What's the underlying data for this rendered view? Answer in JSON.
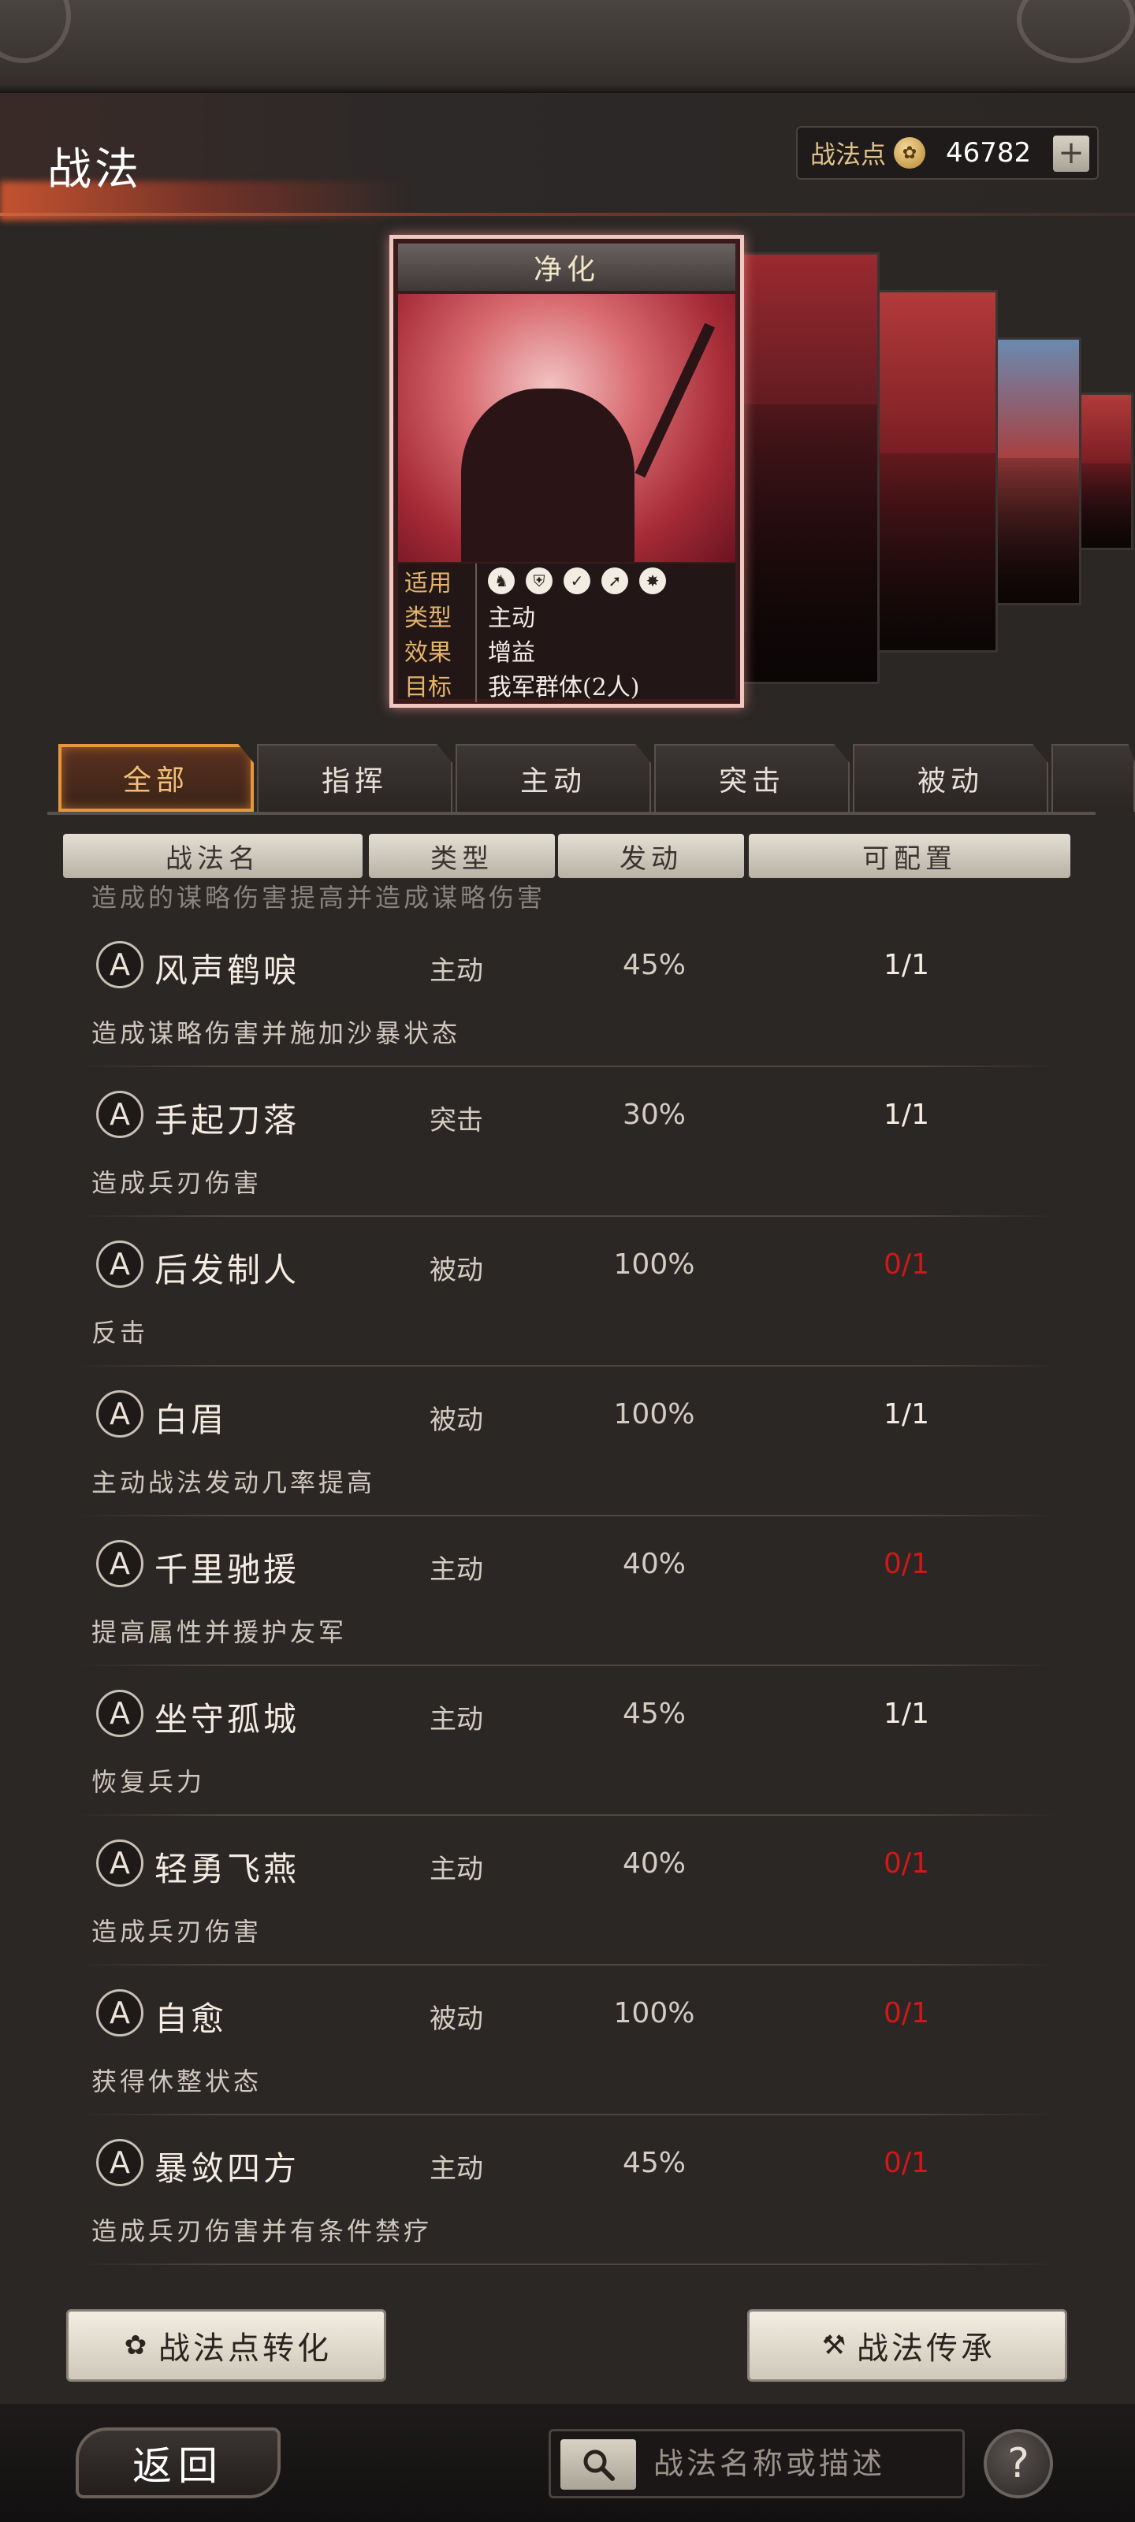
{
  "header": {
    "title": "战法",
    "points_label": "战法点",
    "points_value": "46782",
    "add_label": "+"
  },
  "featured_card": {
    "name": "净化",
    "rows": [
      {
        "key": "适用",
        "value": ""
      },
      {
        "key": "类型",
        "value": "主动"
      },
      {
        "key": "效果",
        "value": "增益"
      },
      {
        "key": "目标",
        "value": "我军群体(2人)"
      }
    ],
    "troop_icons": [
      "cavalry-icon",
      "shield-icon",
      "bow-icon",
      "spear-icon",
      "chariot-icon"
    ]
  },
  "tabs": [
    {
      "label": "全部",
      "active": true
    },
    {
      "label": "指挥",
      "active": false
    },
    {
      "label": "主动",
      "active": false
    },
    {
      "label": "突击",
      "active": false
    },
    {
      "label": "被动",
      "active": false
    }
  ],
  "table_headers": {
    "name": "战法名",
    "type": "类型",
    "rate": "发动",
    "config": "可配置"
  },
  "cut_off_text": "造成的谋略伤害提高并造成谋略伤害",
  "skills": [
    {
      "grade": "A",
      "name": "风声鹤唳",
      "type": "主动",
      "rate": "45%",
      "config": "1/1",
      "desc": "造成谋略伤害并施加沙暴状态",
      "available": true
    },
    {
      "grade": "A",
      "name": "手起刀落",
      "type": "突击",
      "rate": "30%",
      "config": "1/1",
      "desc": "造成兵刃伤害",
      "available": true
    },
    {
      "grade": "A",
      "name": "后发制人",
      "type": "被动",
      "rate": "100%",
      "config": "0/1",
      "desc": "反击",
      "available": false
    },
    {
      "grade": "A",
      "name": "白眉",
      "type": "被动",
      "rate": "100%",
      "config": "1/1",
      "desc": "主动战法发动几率提高",
      "available": true
    },
    {
      "grade": "A",
      "name": "千里驰援",
      "type": "主动",
      "rate": "40%",
      "config": "0/1",
      "desc": "提高属性并援护友军",
      "available": false
    },
    {
      "grade": "A",
      "name": "坐守孤城",
      "type": "主动",
      "rate": "45%",
      "config": "1/1",
      "desc": "恢复兵力",
      "available": true
    },
    {
      "grade": "A",
      "name": "轻勇飞燕",
      "type": "主动",
      "rate": "40%",
      "config": "0/1",
      "desc": "造成兵刃伤害",
      "available": false
    },
    {
      "grade": "A",
      "name": "自愈",
      "type": "被动",
      "rate": "100%",
      "config": "0/1",
      "desc": "获得休整状态",
      "available": false
    },
    {
      "grade": "A",
      "name": "暴敛四方",
      "type": "主动",
      "rate": "45%",
      "config": "0/1",
      "desc": "造成兵刃伤害并有条件禁疗",
      "available": false
    }
  ],
  "buttons": {
    "convert": "战法点转化",
    "inherit": "战法传承",
    "back": "返回",
    "help": "?"
  },
  "search": {
    "placeholder": "战法名称或描述"
  },
  "colors": {
    "accent_orange": "#e8963c",
    "unavailable_red": "#d01818",
    "available_white": "#f4ece0"
  }
}
